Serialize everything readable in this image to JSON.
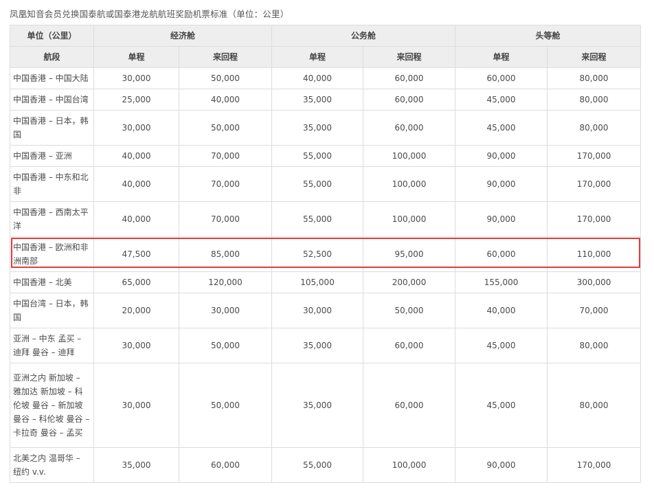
{
  "caption": "凤凰知音会员兑换国泰航或国泰港龙航航班奖励机票标准（单位：公里）",
  "header": {
    "unit_label": "单位（公里）",
    "economy": "经济舱",
    "business": "公务舱",
    "first": "头等舱",
    "segment_label": "航段",
    "one_way": "单程",
    "round_trip": "来回程"
  },
  "rows": [
    {
      "route": "中国香港 – 中国大陆",
      "eco_ow": "30,000",
      "eco_rt": "50,000",
      "bus_ow": "40,000",
      "bus_rt": "60,000",
      "first_ow": "60,000",
      "first_rt": "80,000"
    },
    {
      "route": "中国香港 – 中国台湾",
      "eco_ow": "25,000",
      "eco_rt": "40,000",
      "bus_ow": "35,000",
      "bus_rt": "60,000",
      "first_ow": "45,000",
      "first_rt": "80,000"
    },
    {
      "route": "中国香港 – 日本，韩国",
      "eco_ow": "30,000",
      "eco_rt": "50,000",
      "bus_ow": "35,000",
      "bus_rt": "60,000",
      "first_ow": "45,000",
      "first_rt": "80,000"
    },
    {
      "route": "中国香港 – 亚洲",
      "eco_ow": "40,000",
      "eco_rt": "70,000",
      "bus_ow": "55,000",
      "bus_rt": "100,000",
      "first_ow": "90,000",
      "first_rt": "170,000"
    },
    {
      "route": "中国香港 – 中东和北非",
      "eco_ow": "40,000",
      "eco_rt": "70,000",
      "bus_ow": "55,000",
      "bus_rt": "100,000",
      "first_ow": "90,000",
      "first_rt": "170,000"
    },
    {
      "route": "中国香港 – 西南太平洋",
      "eco_ow": "40,000",
      "eco_rt": "70,000",
      "bus_ow": "55,000",
      "bus_rt": "100,000",
      "first_ow": "90,000",
      "first_rt": "170,000"
    },
    {
      "route": "中国香港 – 欧洲和非洲南部",
      "eco_ow": "47,500",
      "eco_rt": "85,000",
      "bus_ow": "52,500",
      "bus_rt": "95,000",
      "first_ow": "60,000",
      "first_rt": "110,000"
    },
    {
      "route": "中国香港 – 北美",
      "eco_ow": "65,000",
      "eco_rt": "120,000",
      "bus_ow": "105,000",
      "bus_rt": "200,000",
      "first_ow": "155,000",
      "first_rt": "300,000"
    },
    {
      "route": "中国台湾 – 日本，韩国",
      "eco_ow": "20,000",
      "eco_rt": "30,000",
      "bus_ow": "30,000",
      "bus_rt": "50,000",
      "first_ow": "40,000",
      "first_rt": "70,000"
    },
    {
      "route": "亚洲 – 中东 孟买 – 迪拜 曼谷 – 迪拜",
      "eco_ow": "30,000",
      "eco_rt": "50,000",
      "bus_ow": "35,000",
      "bus_rt": "60,000",
      "first_ow": "45,000",
      "first_rt": "80,000"
    },
    {
      "route": "亚洲之内 新加坡 – 雅加达 新加坡 – 科伦坡 曼谷 – 新加坡 曼谷 – 科伦坡 曼谷 – 卡拉奇 曼谷 – 孟买",
      "eco_ow": "30,000",
      "eco_rt": "50,000",
      "bus_ow": "35,000",
      "bus_rt": "60,000",
      "first_ow": "45,000",
      "first_rt": "80,000"
    },
    {
      "route": "北美之内 温哥华 – 纽约 v.v.",
      "eco_ow": "35,000",
      "eco_rt": "60,000",
      "bus_ow": "55,000",
      "bus_rt": "100,000",
      "first_ow": "90,000",
      "first_rt": "170,000"
    }
  ]
}
